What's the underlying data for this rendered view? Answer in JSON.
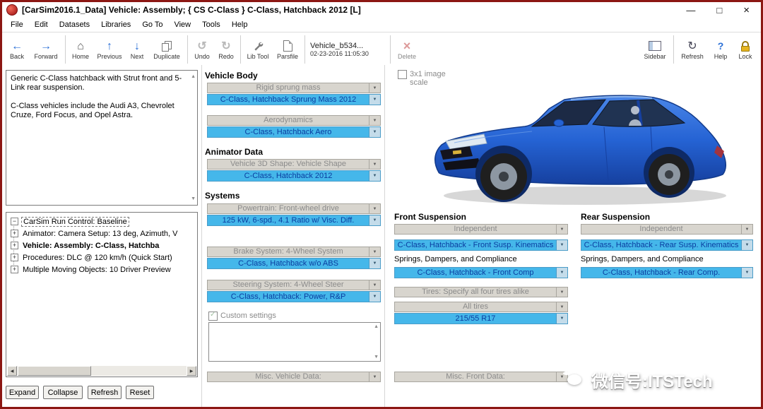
{
  "colors": {
    "frame_red": "#8c1713",
    "accent_blue": "#45b7ea",
    "link_text": "#0a3da0",
    "gray_row": "#d8d5ce"
  },
  "window": {
    "title": "[CarSim2016.1_Data] Vehicle: Assembly; { CS C-Class } C-Class, Hatchback 2012 [L]"
  },
  "menu": {
    "items": [
      "File",
      "Edit",
      "Datasets",
      "Libraries",
      "Go To",
      "View",
      "Tools",
      "Help"
    ]
  },
  "toolbar": {
    "buttons": [
      {
        "label": "Back"
      },
      {
        "label": "Forward"
      },
      {
        "label": "Home"
      },
      {
        "label": "Previous"
      },
      {
        "label": "Next"
      },
      {
        "label": "Duplicate"
      },
      {
        "label": "Undo"
      },
      {
        "label": "Redo"
      },
      {
        "label": "Lib Tool"
      },
      {
        "label": "Parsfile"
      },
      {
        "label": "Delete"
      },
      {
        "label": "Sidebar"
      },
      {
        "label": "Refresh"
      },
      {
        "label": "Help"
      },
      {
        "label": "Lock"
      }
    ],
    "dataset": {
      "name": "Vehicle_b534...",
      "date": "02-23-2016 11:05:30"
    }
  },
  "left": {
    "description": {
      "p1": "Generic C-Class hatchback with Strut front and 5-Link rear suspension.",
      "p2": "C-Class vehicles include the Audi A3, Chevrolet Cruze, Ford Focus, and Opel Astra."
    },
    "tree": {
      "items": [
        {
          "toggle": "−",
          "label": "CarSim Run Control: Baseline"
        },
        {
          "toggle": "+",
          "label": "Animator: Camera Setup: 13 deg, Azimuth, V"
        },
        {
          "toggle": "+",
          "label": "Vehicle: Assembly: C-Class, Hatchba"
        },
        {
          "toggle": "+",
          "label": "Procedures: DLC @ 120 km/h (Quick Start)"
        },
        {
          "toggle": "+",
          "label": "Multiple Moving Objects: 10 Driver Preview"
        }
      ]
    },
    "buttons": {
      "expand": "Expand",
      "collapse": "Collapse",
      "refresh": "Refresh",
      "reset": "Reset"
    }
  },
  "middle": {
    "vehicle_body": {
      "header": "Vehicle Body",
      "rigid_label": "Rigid sprung mass",
      "rigid_value": "C-Class, Hatchback Sprung Mass 2012",
      "aero_label": "Aerodynamics",
      "aero_value": "C-Class, Hatchback Aero"
    },
    "animator": {
      "header": "Animator Data",
      "shape_label": "Vehicle 3D Shape: Vehicle Shape",
      "shape_value": "C-Class, Hatchback 2012"
    },
    "systems": {
      "header": "Systems",
      "powertrain_label": "Powertrain: Front-wheel drive",
      "powertrain_value": "125 kW, 6-spd., 4.1 Ratio w/ Visc. Diff.",
      "brake_label": "Brake System: 4-Wheel System",
      "brake_value": "C-Class, Hatchback w/o ABS",
      "steering_label": "Steering System: 4-Wheel Steer",
      "steering_value": "C-Class, Hatchback: Power, R&P"
    },
    "custom_settings_label": "Custom settings",
    "misc_vehicle_label": "Misc. Vehicle Data:"
  },
  "right": {
    "image_scale_label": "3x1 image scale",
    "front": {
      "header": "Front Suspension",
      "type": "Independent",
      "kinematics": "C-Class, Hatchback - Front Susp. Kinematics",
      "springs_label": "Springs, Dampers, and Compliance",
      "compliance": "C-Class, Hatchback - Front Comp"
    },
    "rear": {
      "header": "Rear Suspension",
      "type": "Independent",
      "kinematics": "C-Class, Hatchback - Rear Susp. Kinematics",
      "springs_label": "Springs, Dampers, and Compliance",
      "compliance": "C-Class, Hatchback - Rear Comp."
    },
    "tires": {
      "label": "Tires: Specify all four tires alike",
      "scope": "All tires",
      "size": "215/55 R17"
    },
    "misc_front_label": "Misc. Front Data:"
  },
  "watermark": "微信号:ITSTech"
}
